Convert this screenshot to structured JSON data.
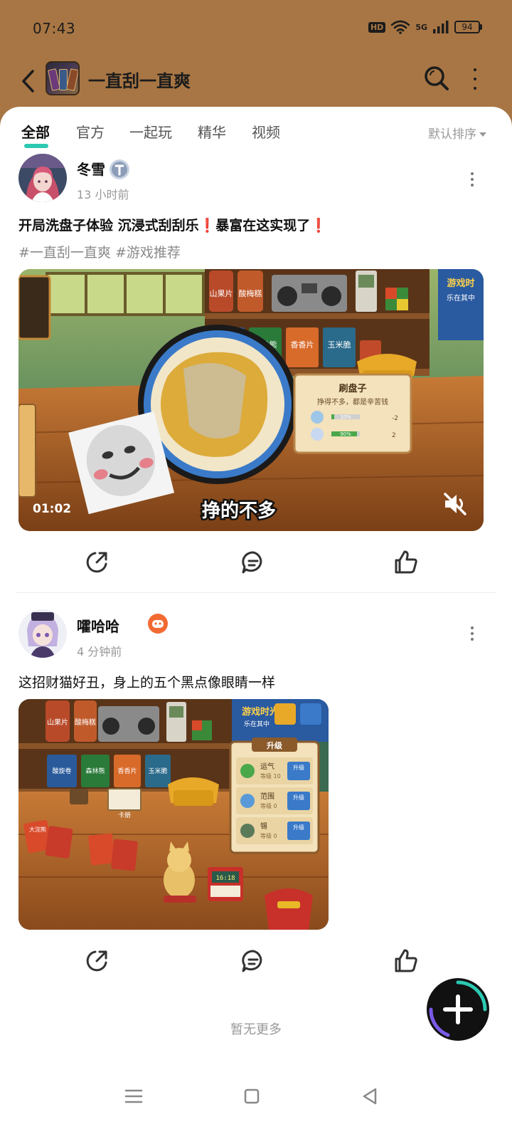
{
  "status_bar": {
    "time": "07:43",
    "hd": "HD",
    "network": "5G",
    "battery": "94"
  },
  "header": {
    "title": "一直刮一直爽"
  },
  "tabs": [
    "全部",
    "官方",
    "一起玩",
    "精华",
    "视频"
  ],
  "active_tab": "全部",
  "sort_label": "默认排序",
  "posts": [
    {
      "author": "冬雪",
      "time": "13 小时前",
      "title_parts": [
        "开局洗盘子体验 沉浸式刮刮乐",
        "❗",
        "暴富在这实现了",
        "❗"
      ],
      "tags": "#一直刮一直爽 #游戏推荐",
      "video": {
        "duration": "01:02",
        "subtitle": "挣的不多",
        "card_title": "刷盘子",
        "card_desc": "挣得不多，都是辛苦钱",
        "card_bar1": "10%",
        "card_bar1_value": 0.1,
        "card_bar2": "90%",
        "card_bar2_value": 0.9,
        "card_cost1": "-2",
        "card_cost2": "2",
        "shelf_labels": [
          "山果片",
          "酸梅糕",
          "森林熊",
          "香香片",
          "玉米脆"
        ],
        "sign_text_1": "游戏时",
        "sign_text_2": "乐在其中"
      }
    },
    {
      "author": "嚯哈哈",
      "time": "4 分钟前",
      "title": "这招财猫好丑，身上的五个黑点像眼睛一样",
      "image": {
        "panel_title": "升级",
        "upgrades": [
          {
            "name": "运气",
            "level": "等级 10",
            "btn": "升级"
          },
          {
            "name": "范围",
            "level": "等级 0",
            "btn": "升级"
          },
          {
            "name": "锡",
            "level": "等级 0",
            "btn": "升级"
          }
        ],
        "shelf_labels": [
          "山果片",
          "酸梅糕",
          "酸旋卷",
          "森林熊",
          "香香片",
          "玉米脆"
        ],
        "sign_text_1": "游戏时光",
        "sign_text_2": "乐在其中",
        "card_label": "卡册",
        "bag_label": "大浣熊",
        "register_display": "16:18"
      }
    }
  ],
  "no_more": "暂无更多",
  "colors": {
    "header_bg": "#a87644",
    "accent_underline": "#2cc9b2",
    "exclamation": "#e23a3a"
  }
}
